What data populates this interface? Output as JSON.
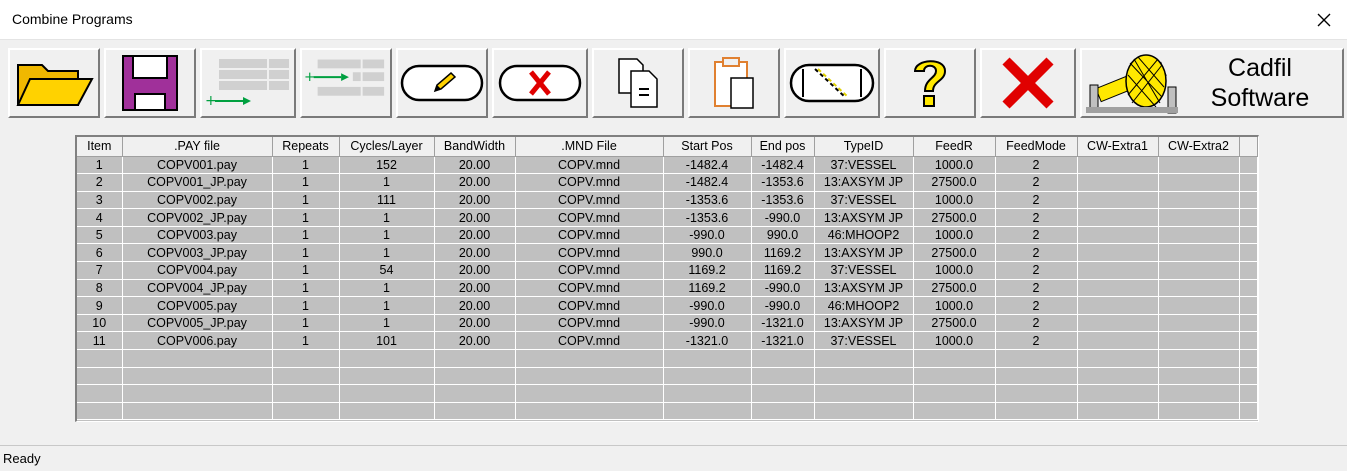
{
  "window": {
    "title": "Combine Programs"
  },
  "toolbar": {
    "buttons": [
      {
        "name": "open-folder-button",
        "icon": "folder-icon"
      },
      {
        "name": "save-button",
        "icon": "floppy-disk-icon"
      },
      {
        "name": "add-rows-button",
        "icon": "add-rows-icon"
      },
      {
        "name": "insert-rows-button",
        "icon": "insert-rows-icon"
      },
      {
        "name": "edit-button",
        "icon": "pencil-icon"
      },
      {
        "name": "delete-button",
        "icon": "delete-x-icon"
      },
      {
        "name": "copy-button",
        "icon": "copy-icon"
      },
      {
        "name": "paste-button",
        "icon": "clipboard-icon"
      },
      {
        "name": "path-view-button",
        "icon": "winding-path-icon"
      },
      {
        "name": "help-button",
        "icon": "question-icon"
      },
      {
        "name": "exit-button",
        "icon": "red-x-icon"
      }
    ],
    "logo": {
      "line1": "Cadfil",
      "line2": "Software"
    }
  },
  "grid": {
    "columns": [
      "Item",
      ".PAY file",
      "Repeats",
      "Cycles/Layer",
      "BandWidth",
      ".MND File",
      "Start Pos",
      "End pos",
      "TypeID",
      "FeedR",
      "FeedMode",
      "CW-Extra1",
      "CW-Extra2"
    ],
    "rows": [
      [
        "1",
        "COPV001.pay",
        "1",
        "152",
        "20.00",
        "COPV.mnd",
        "-1482.4",
        "-1482.4",
        "37:VESSEL",
        "1000.0",
        "2",
        "",
        ""
      ],
      [
        "2",
        "COPV001_JP.pay",
        "1",
        "1",
        "20.00",
        "COPV.mnd",
        "-1482.4",
        "-1353.6",
        "13:AXSYM JP",
        "27500.0",
        "2",
        "",
        ""
      ],
      [
        "3",
        "COPV002.pay",
        "1",
        "111",
        "20.00",
        "COPV.mnd",
        "-1353.6",
        "-1353.6",
        "37:VESSEL",
        "1000.0",
        "2",
        "",
        ""
      ],
      [
        "4",
        "COPV002_JP.pay",
        "1",
        "1",
        "20.00",
        "COPV.mnd",
        "-1353.6",
        "-990.0",
        "13:AXSYM JP",
        "27500.0",
        "2",
        "",
        ""
      ],
      [
        "5",
        "COPV003.pay",
        "1",
        "1",
        "20.00",
        "COPV.mnd",
        "-990.0",
        "990.0",
        "46:MHOOP2",
        "1000.0",
        "2",
        "",
        ""
      ],
      [
        "6",
        "COPV003_JP.pay",
        "1",
        "1",
        "20.00",
        "COPV.mnd",
        "990.0",
        "1169.2",
        "13:AXSYM JP",
        "27500.0",
        "2",
        "",
        ""
      ],
      [
        "7",
        "COPV004.pay",
        "1",
        "54",
        "20.00",
        "COPV.mnd",
        "1169.2",
        "1169.2",
        "37:VESSEL",
        "1000.0",
        "2",
        "",
        ""
      ],
      [
        "8",
        "COPV004_JP.pay",
        "1",
        "1",
        "20.00",
        "COPV.mnd",
        "1169.2",
        "-990.0",
        "13:AXSYM JP",
        "27500.0",
        "2",
        "",
        ""
      ],
      [
        "9",
        "COPV005.pay",
        "1",
        "1",
        "20.00",
        "COPV.mnd",
        "-990.0",
        "-990.0",
        "46:MHOOP2",
        "1000.0",
        "2",
        "",
        ""
      ],
      [
        "10",
        "COPV005_JP.pay",
        "1",
        "1",
        "20.00",
        "COPV.mnd",
        "-990.0",
        "-1321.0",
        "13:AXSYM JP",
        "27500.0",
        "2",
        "",
        ""
      ],
      [
        "11",
        "COPV006.pay",
        "1",
        "101",
        "20.00",
        "COPV.mnd",
        "-1321.0",
        "-1321.0",
        "37:VESSEL",
        "1000.0",
        "2",
        "",
        ""
      ]
    ]
  },
  "status": {
    "text": "Ready"
  }
}
